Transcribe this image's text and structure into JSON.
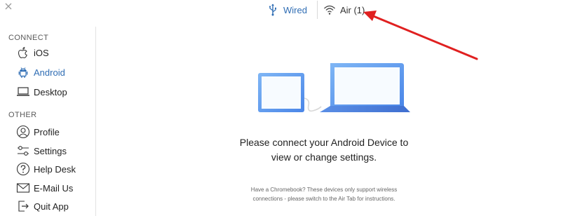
{
  "window": {
    "close_icon": "close-icon"
  },
  "topbar": {
    "tabs": [
      {
        "label": "Wired",
        "icon": "usb-icon",
        "active": true
      },
      {
        "label": "Air (1)",
        "icon": "wifi-icon",
        "active": false
      }
    ]
  },
  "sidebar": {
    "connect_title": "CONNECT",
    "connect_items": [
      {
        "label": "iOS",
        "icon": "apple-icon"
      },
      {
        "label": "Android",
        "icon": "android-icon",
        "active": true
      },
      {
        "label": "Desktop",
        "icon": "laptop-icon"
      }
    ],
    "other_title": "OTHER",
    "other_items": [
      {
        "label": "Profile",
        "icon": "profile-icon"
      },
      {
        "label": "Settings",
        "icon": "settings-icon"
      },
      {
        "label": "Help Desk",
        "icon": "help-icon"
      },
      {
        "label": "E-Mail Us",
        "icon": "email-icon"
      },
      {
        "label": "Quit App",
        "icon": "quit-icon"
      }
    ]
  },
  "main": {
    "message_line1": "Please connect your Android Device to",
    "message_line2": "view or change settings.",
    "note_line1": "Have a Chromebook? These devices only support wireless",
    "note_line2": "connections - please switch to the Air Tab for instructions."
  },
  "colors": {
    "accent": "#2f6db4",
    "annotation": "#e02020"
  }
}
